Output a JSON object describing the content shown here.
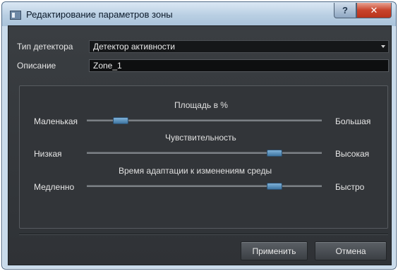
{
  "window": {
    "title": "Редактирование параметров зоны",
    "help_glyph": "?",
    "close_glyph": "✕"
  },
  "form": {
    "detector_label": "Тип детектора",
    "detector_value": "Детектор активности",
    "description_label": "Описание",
    "description_value": "Zone_1"
  },
  "sliders": [
    {
      "title": "Площадь в %",
      "min_label": "Маленькая",
      "max_label": "Большая",
      "value_fraction": 0.12
    },
    {
      "title": "Чувствительность",
      "min_label": "Низкая",
      "max_label": "Высокая",
      "value_fraction": 0.82
    },
    {
      "title": "Время адаптации к изменениям среды",
      "min_label": "Медленно",
      "max_label": "Быстро",
      "value_fraction": 0.82
    }
  ],
  "buttons": {
    "apply_label": "Применить",
    "cancel_label": "Отмена"
  },
  "colors": {
    "dialog_background": "#35383c",
    "slider_thumb": "#5a92c0",
    "close_button": "#c8432b"
  }
}
